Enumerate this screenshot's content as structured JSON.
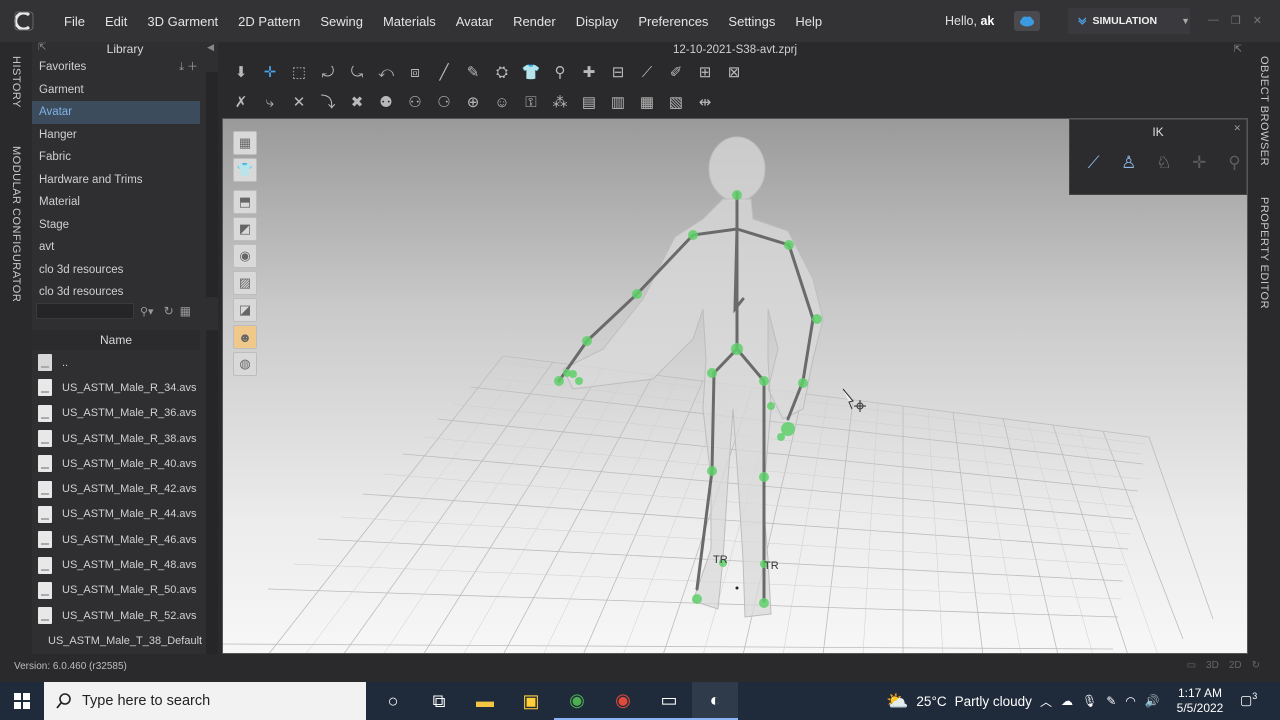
{
  "menu": [
    "File",
    "Edit",
    "3D Garment",
    "2D Pattern",
    "Sewing",
    "Materials",
    "Avatar",
    "Render",
    "Display",
    "Preferences",
    "Settings",
    "Help"
  ],
  "greeting": {
    "prefix": "Hello,",
    "user": "ak"
  },
  "mode_button": "SIMULATION",
  "left_tabs": {
    "history": "HISTORY",
    "modular": "MODULAR CONFIGURATOR"
  },
  "right_tabs": {
    "object_browser": "OBJECT BROWSER",
    "property_editor": "PROPERTY EDITOR"
  },
  "library": {
    "title": "Library",
    "categories": [
      "Favorites",
      "Garment",
      "Avatar",
      "Hanger",
      "Fabric",
      "Hardware and Trims",
      "Material",
      "Stage",
      "avt",
      "clo 3d resources",
      "clo 3d resources"
    ],
    "selected_category": "Avatar",
    "name_header": "Name",
    "files": [
      "..",
      "US_ASTM_Male_R_34.avs",
      "US_ASTM_Male_R_36.avs",
      "US_ASTM_Male_R_38.avs",
      "US_ASTM_Male_R_40.avs",
      "US_ASTM_Male_R_42.avs",
      "US_ASTM_Male_R_44.avs",
      "US_ASTM_Male_R_46.avs",
      "US_ASTM_Male_R_48.avs",
      "US_ASTM_Male_R_50.avs",
      "US_ASTM_Male_R_52.avs",
      "US_ASTM_Male_T_38_Default"
    ]
  },
  "document_title": "12-10-2021-S38-avt.zprj",
  "ik_panel": {
    "title": "IK"
  },
  "viewport_labels": {
    "left_foot": "TR",
    "right_foot": "TR"
  },
  "version": "Version: 6.0.460 (r32585)",
  "status_icons": [
    "3D",
    "2D"
  ],
  "taskbar": {
    "search_placeholder": "Type here to search",
    "weather_temp": "25°C",
    "weather_text": "Partly cloudy",
    "time": "1:17 AM",
    "date": "5/5/2022",
    "notifications": "3"
  },
  "colors": {
    "accent": "#4aa3e8",
    "selection": "#3d4c5c",
    "joint": "#5fd06a",
    "bone": "#6a6a6a"
  }
}
